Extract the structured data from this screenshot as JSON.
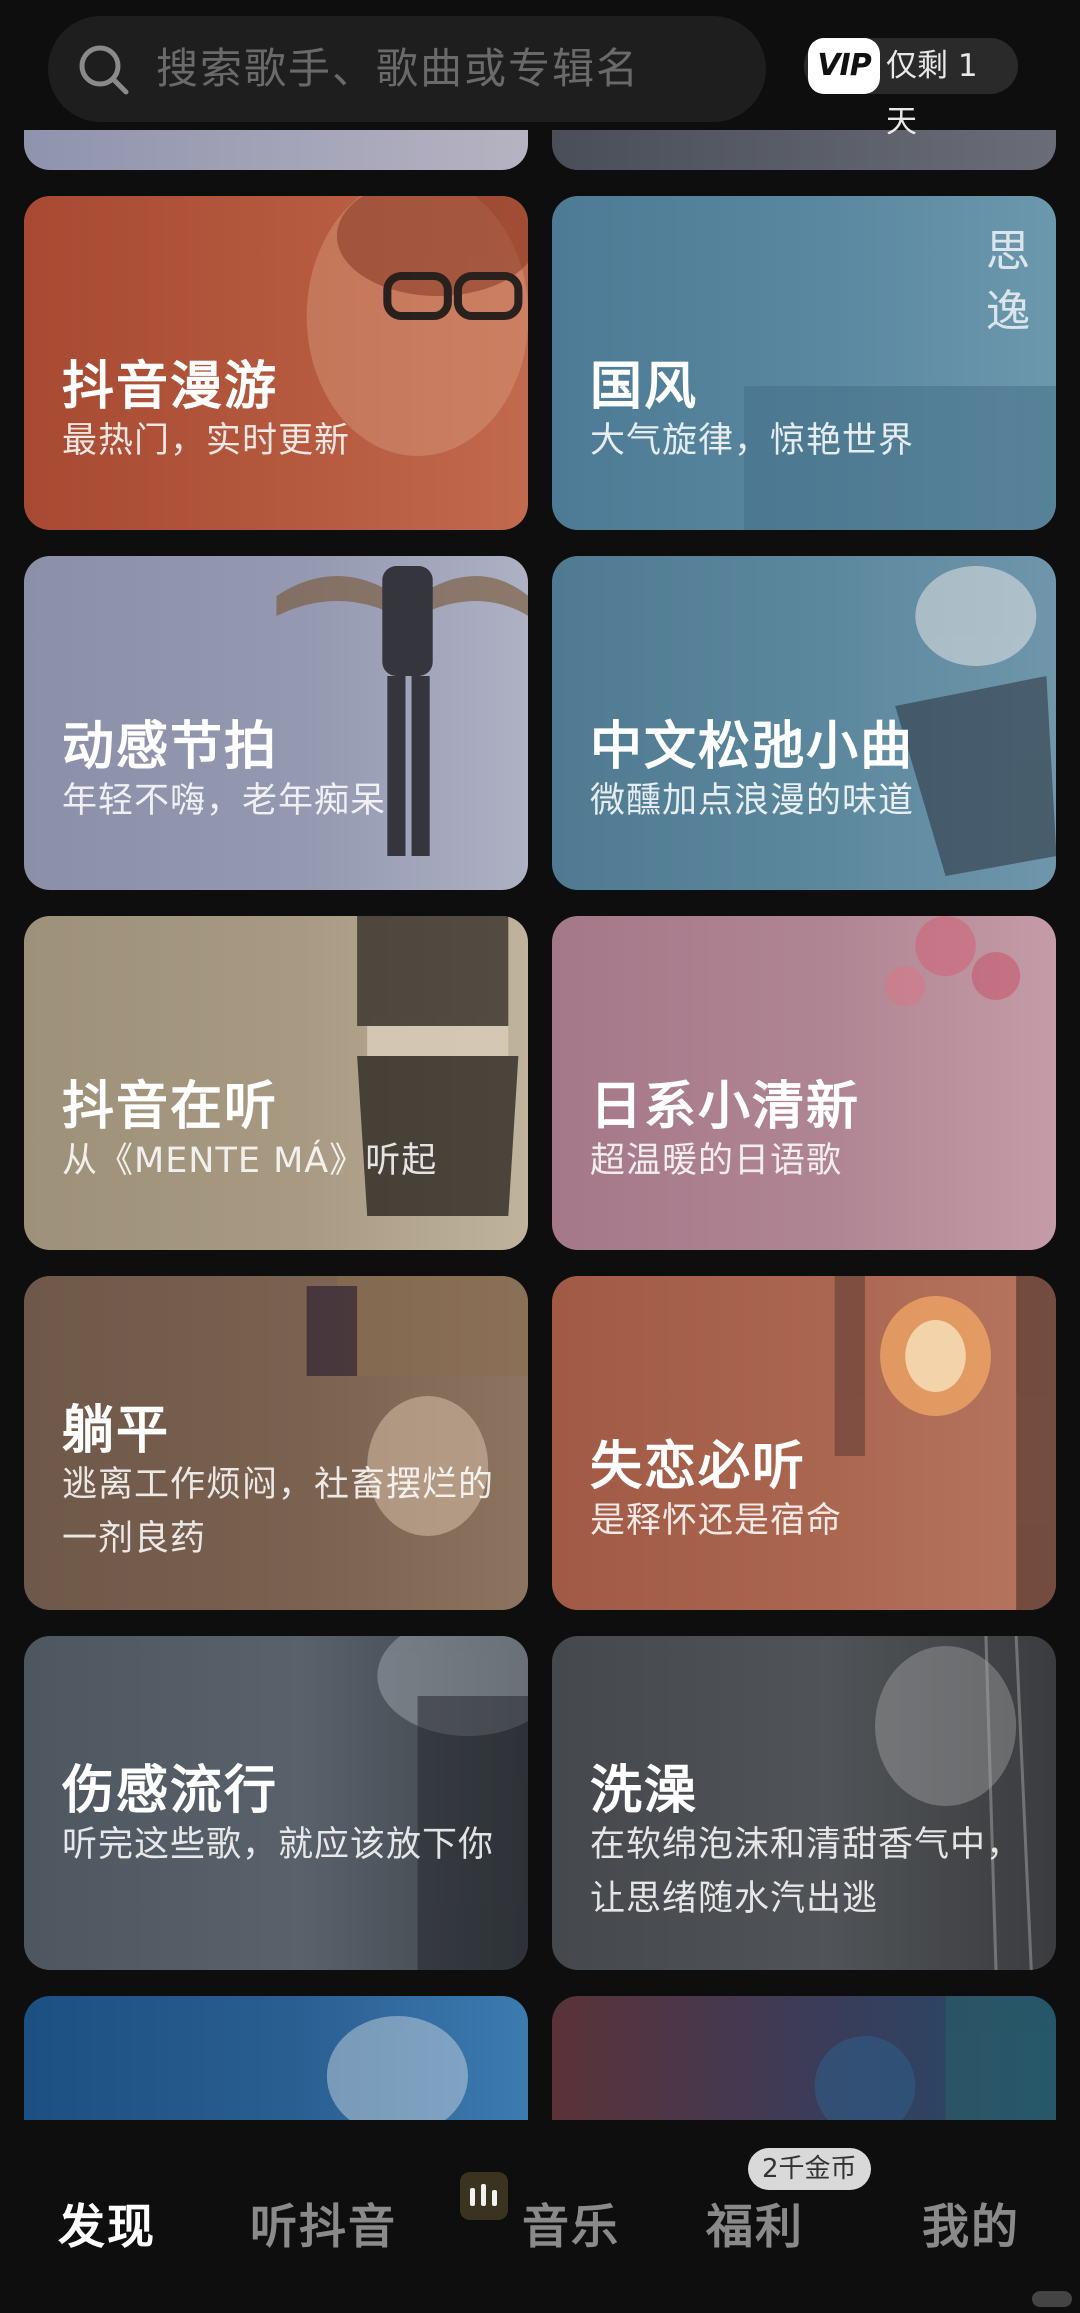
{
  "search": {
    "placeholder": "搜索歌手、歌曲或专辑名"
  },
  "vip": {
    "badge": "VIP",
    "label": "仅剩 1 天"
  },
  "cards": [
    {
      "title": "抖音漫游",
      "subtitle": "最热门，实时更新"
    },
    {
      "title": "国风",
      "subtitle": "大气旋律，惊艳世界"
    },
    {
      "title": "动感节拍",
      "subtitle": "年轻不嗨，老年痴呆"
    },
    {
      "title": "中文松弛小曲",
      "subtitle": "微醺加点浪漫的味道"
    },
    {
      "title": "抖音在听",
      "subtitle": "从《MENTE MÁ》听起"
    },
    {
      "title": "日系小清新",
      "subtitle": "超温暖的日语歌"
    },
    {
      "title": "躺平",
      "subtitle": "逃离工作烦闷，社畜摆烂的一剂良药"
    },
    {
      "title": "失恋必听",
      "subtitle": "是释怀还是宿命"
    },
    {
      "title": "伤感流行",
      "subtitle": "听完这些歌，就应该放下你"
    },
    {
      "title": "洗澡",
      "subtitle": "在软绵泡沫和清甜香气中，让思绪随水汽出逃"
    }
  ],
  "nav": {
    "items": [
      {
        "label": "发现",
        "active": true
      },
      {
        "label": "听抖音",
        "active": false
      },
      {
        "label": "音乐",
        "active": false
      },
      {
        "label": "福利",
        "active": false
      },
      {
        "label": "我的",
        "active": false
      }
    ],
    "coin_badge": "2千金币"
  }
}
